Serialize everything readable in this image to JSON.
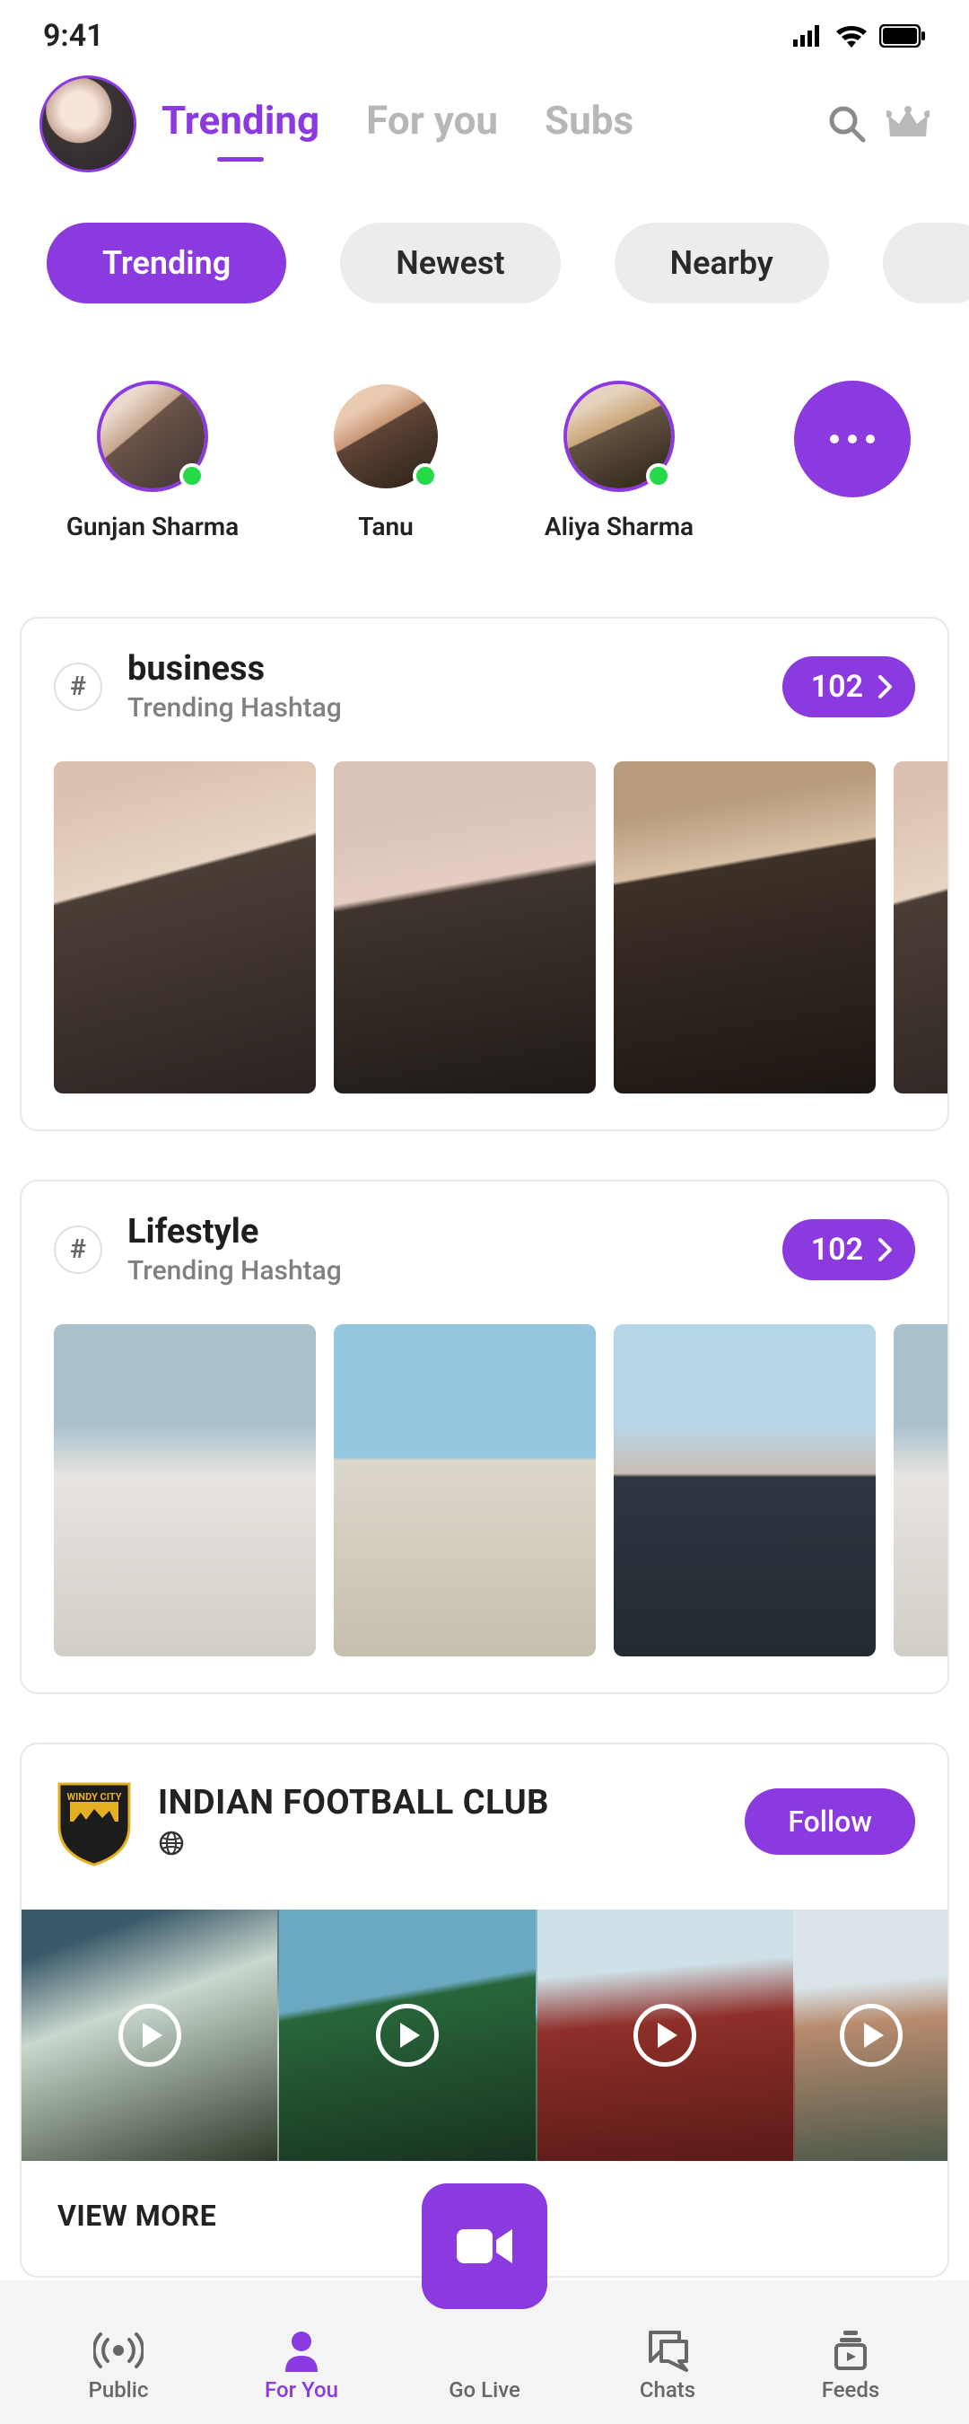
{
  "status": {
    "time": "9:41"
  },
  "header": {
    "tabs": [
      "Trending",
      "For you",
      "Subs"
    ],
    "active_tab": 0
  },
  "filters": {
    "items": [
      "Trending",
      "Newest",
      "Nearby"
    ],
    "active": 0
  },
  "stories": [
    {
      "name": "Gunjan Sharma",
      "ring": true,
      "online": true
    },
    {
      "name": "Tanu",
      "ring": false,
      "online": true
    },
    {
      "name": "Aliya Sharma",
      "ring": true,
      "online": true
    }
  ],
  "hashtags": [
    {
      "tag": "business",
      "subtitle": "Trending Hashtag",
      "count": "102"
    },
    {
      "tag": "Lifestyle",
      "subtitle": "Trending Hashtag",
      "count": "102"
    }
  ],
  "club": {
    "name": "INDIAN FOOTBALL CLUB",
    "follow_label": "Follow",
    "view_more": "VIEW MORE"
  },
  "nav": {
    "items": [
      "Public",
      "For You",
      "Go Live",
      "Chats",
      "Feeds"
    ],
    "active": 1
  }
}
